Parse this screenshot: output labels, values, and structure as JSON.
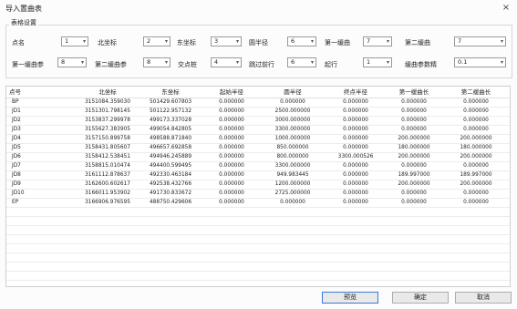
{
  "window": {
    "title": "导入置曲表",
    "close_icon": "×"
  },
  "settings": {
    "group_label": "表格设置",
    "row1": [
      {
        "label": "点名",
        "value": "1"
      },
      {
        "label": "北坐标",
        "value": "2"
      },
      {
        "label": "东坐标",
        "value": "3"
      },
      {
        "label": "圆半径",
        "value": "6"
      },
      {
        "label": "第一缓曲",
        "value": "7"
      },
      {
        "label": "第二缓曲",
        "value": "7"
      }
    ],
    "row2": [
      {
        "label": "第一缓曲参",
        "value": "8"
      },
      {
        "label": "第二缓曲参",
        "value": "8"
      },
      {
        "label": "交点桩",
        "value": "4"
      },
      {
        "label": "跳过前行",
        "value": "6"
      },
      {
        "label": "起行",
        "value": "1"
      },
      {
        "label": "缓曲参数精",
        "value": "0.1"
      }
    ]
  },
  "table": {
    "columns": [
      "点号",
      "北坐标",
      "东坐标",
      "起始半径",
      "圆半径",
      "终点半径",
      "第一缓曲长",
      "第二缓曲长"
    ],
    "rows": [
      [
        "BP",
        "3151084.359030",
        "501429.607803",
        "0.000000",
        "0.000000",
        "0.000000",
        "0.000000",
        "0.000000"
      ],
      [
        "JD1",
        "3151301.798145",
        "501122.957132",
        "0.000000",
        "2500.000000",
        "0.000000",
        "0.000000",
        "0.000000"
      ],
      [
        "JD2",
        "3153837.299978",
        "499173.337028",
        "0.000000",
        "3000.000000",
        "0.000000",
        "0.000000",
        "0.000000"
      ],
      [
        "JD3",
        "3155627.383905",
        "499054.842805",
        "0.000000",
        "3300.000000",
        "0.000000",
        "0.000000",
        "0.000000"
      ],
      [
        "JD4",
        "3157150.899758",
        "498588.871840",
        "0.000000",
        "1000.000000",
        "0.000000",
        "200.000000",
        "200.000000"
      ],
      [
        "JD5",
        "3158431.805607",
        "496657.692858",
        "0.000000",
        "850.000000",
        "0.000000",
        "180.000000",
        "180.000000"
      ],
      [
        "JD6",
        "3158412.538451",
        "494946.245889",
        "0.000000",
        "800.000000",
        "3300.000526",
        "200.000000",
        "200.000000"
      ],
      [
        "JD7",
        "3158815.010474",
        "494400.599495",
        "0.000000",
        "3300.000000",
        "0.000000",
        "0.000000",
        "0.000000"
      ],
      [
        "JD8",
        "3161112.878637",
        "492330.463184",
        "0.000000",
        "949.983445",
        "0.000000",
        "189.997000",
        "189.997000"
      ],
      [
        "JD9",
        "3162600.602617",
        "492538.432766",
        "0.000000",
        "1200.000000",
        "0.000000",
        "200.000000",
        "200.000000"
      ],
      [
        "JD10",
        "3166011.953902",
        "491730.833672",
        "0.000000",
        "2725.000000",
        "0.000000",
        "0.000000",
        "0.000000"
      ],
      [
        "EP",
        "3166906.976595",
        "488750.429606",
        "0.000000",
        "0.000000",
        "0.000000",
        "0.000000",
        "0.000000"
      ]
    ]
  },
  "buttons": {
    "preview": "预览",
    "ok": "确定",
    "cancel": "取消"
  }
}
